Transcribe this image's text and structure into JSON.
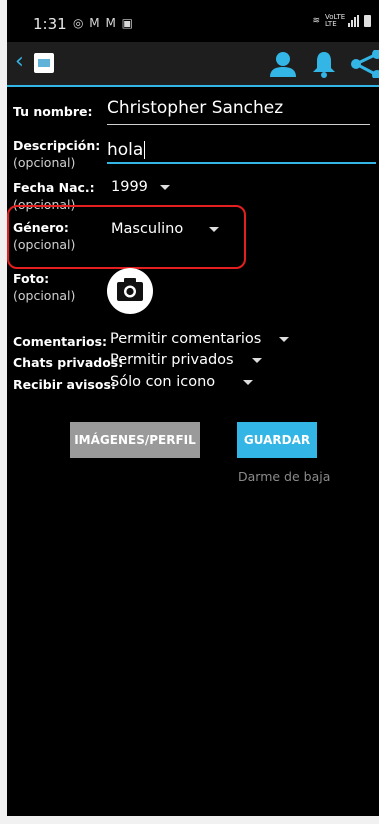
{
  "status_bar": {
    "time": "1:31",
    "notif_icons": [
      "instagram-icon",
      "gmail-icon",
      "gmail-icon",
      "gallery-icon"
    ],
    "network_label": "VoLTE LTE",
    "icons": [
      "wifi-icon",
      "signal-icon",
      "battery-icon"
    ]
  },
  "toolbar": {
    "back_icon": "chevron-left-icon",
    "actions": [
      "person-icon",
      "bell-icon",
      "share-icon"
    ],
    "accent": "#33b5e5"
  },
  "form": {
    "name_label": "Tu nombre:",
    "name_value": "Christopher Sanchez",
    "desc_label": "Descripción:",
    "desc_optional": "(opcional)",
    "desc_value": "hola",
    "birth_label": "Fecha Nac.:",
    "birth_optional": "(opcional)",
    "birth_value": "1999",
    "gender_label": "Género:",
    "gender_optional": "(opcional)",
    "gender_value": "Masculino",
    "photo_label": "Foto:",
    "photo_optional": "(opcional)",
    "comments_label": "Comentarios:",
    "comments_value": "Permitir comentarios",
    "chats_label": "Chats privados:",
    "chats_value": "Permitir privados",
    "notify_label": "Recibir avisos:",
    "notify_value": "Sólo con icono"
  },
  "buttons": {
    "images_label": "IMÁGENES/PERFIL",
    "save_label": "GUARDAR",
    "unsubscribe_label": "Darme de baja"
  },
  "colors": {
    "accent": "#33b5e5",
    "highlight": "#e51f1f",
    "background": "#000000"
  }
}
